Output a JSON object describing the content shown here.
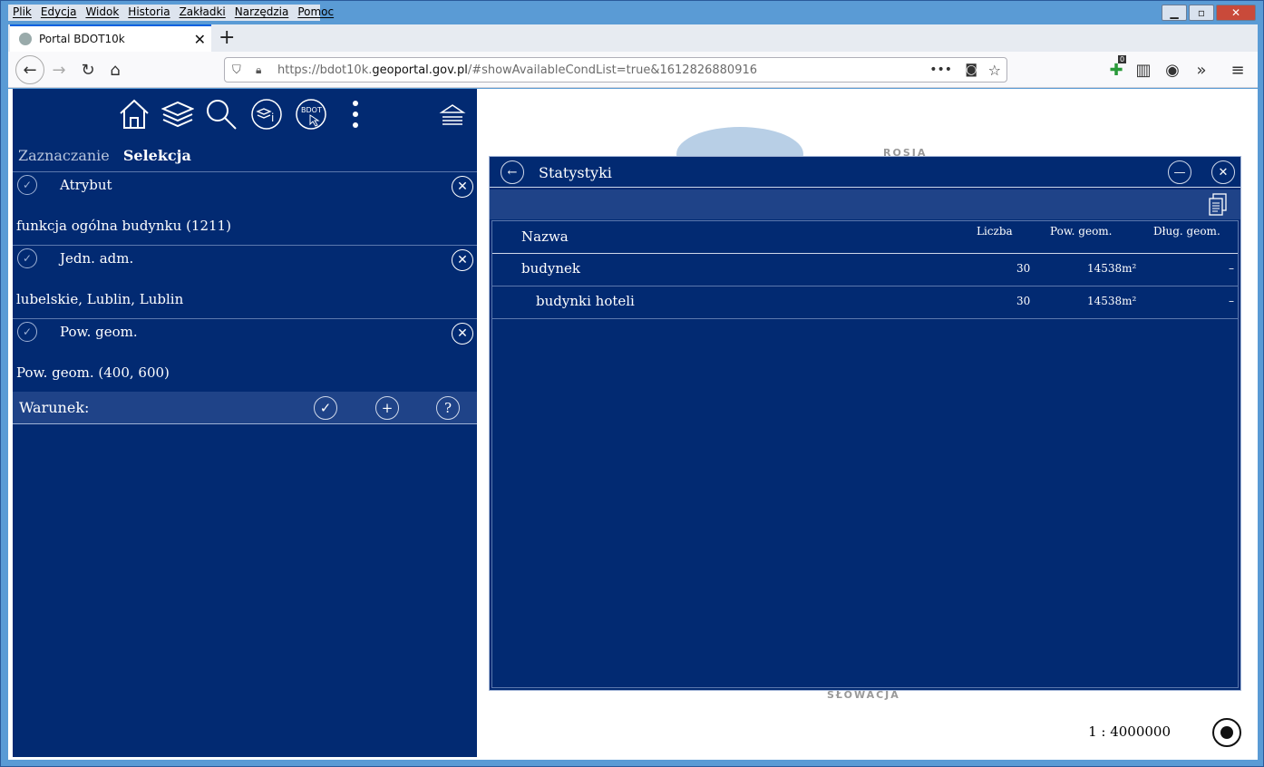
{
  "menu": [
    "Plik",
    "Edycja",
    "Widok",
    "Historia",
    "Zakładki",
    "Narzędzia",
    "Pomoc"
  ],
  "tab": {
    "title": "Portal BDOT10k"
  },
  "url": {
    "prefix": "https://bdot10k.",
    "domain": "geoportal.gov.pl",
    "rest": "/#showAvailableCondList=true&1612826880916"
  },
  "ext_badge": "0",
  "modes": {
    "zaznaczanie": "Zaznaczanie",
    "selekcja": "Selekcja"
  },
  "toolbar": {
    "bdot_label": "BDOT"
  },
  "conditions": [
    {
      "name": "Atrybut",
      "value": "funkcja ogólna budynku (1211)"
    },
    {
      "name": "Jedn. adm.",
      "value": "lubelskie, Lublin, Lublin"
    },
    {
      "name": "Pow. geom.",
      "value": "Pow. geom. (400, 600)"
    }
  ],
  "warunek": {
    "label": "Warunek:",
    "help": "?"
  },
  "map": {
    "label_north": "ROSJA",
    "label_south": "SŁOWACJA",
    "scale": "1 : 4000000"
  },
  "stats": {
    "title": "Statystyki",
    "columns": [
      "Nazwa",
      "Liczba",
      "Pow. geom.",
      "Dług. geom."
    ],
    "rows": [
      {
        "name": "budynek",
        "count": "30",
        "area": "14538m²",
        "length": "–"
      },
      {
        "name": "budynki hoteli",
        "count": "30",
        "area": "14538m²",
        "length": "–"
      }
    ]
  }
}
